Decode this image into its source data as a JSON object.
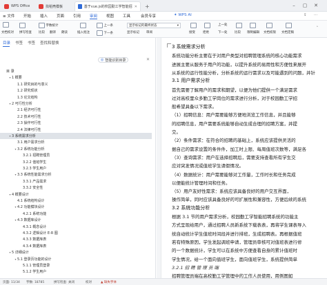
{
  "titlebar": {
    "tabs": [
      {
        "label": "WPS Office",
        "color": "#e23b36"
      },
      {
        "label": "找稻壳模板",
        "color": "#e23b36"
      },
      {
        "label": "基于vue.js的校园勤工学智能招聘系统",
        "color": "#2f6bd8"
      }
    ],
    "add_tab": "+"
  },
  "menubar": {
    "file": "≡ 文件",
    "items": [
      "开始",
      "插入",
      "页面",
      "引用",
      "审阅",
      "视图",
      "工具",
      "会员专享"
    ],
    "active": "审阅",
    "wps_ai": "WPS AI"
  },
  "ribbon": {
    "labels": {
      "doc_check": "文档校对",
      "spell": "拼写检查",
      "word_count": "字数统计",
      "compare": "比较",
      "translate": "翻译",
      "read_aloud": "朗读",
      "insert_comment": "插入批注",
      "prev_comment": "上一条",
      "next_comment": "下一条",
      "show_markup": "显示标记的最终状态",
      "show_markup_menu": "显示标记",
      "review": "审阅",
      "accept": "接受",
      "reject": "拒绝",
      "prev": "上一处",
      "next": "下一处",
      "compare2": "比较",
      "restrict": "限制编辑",
      "doc_rights": "文档权限",
      "doc_locate": "文档定稿"
    }
  },
  "leftpanel": {
    "tabs": [
      "目录",
      "书签",
      "书签",
      "查找和替换"
    ],
    "active": "目录",
    "smart_toc": "智能识别目录",
    "toc": [
      {
        "label": "目 录",
        "level": 0,
        "arrow": ""
      },
      {
        "label": "1 概要",
        "level": 1,
        "arrow": "▾"
      },
      {
        "label": "1.1 研究目的与意义",
        "level": 2,
        "arrow": ""
      },
      {
        "label": "1.2 研究现状",
        "level": 2,
        "arrow": ""
      },
      {
        "label": "1.3 论文结构",
        "level": 2,
        "arrow": ""
      },
      {
        "label": "2 可行性分析",
        "level": 1,
        "arrow": "▾"
      },
      {
        "label": "2.1 经济可行性",
        "level": 2,
        "arrow": ""
      },
      {
        "label": "2.2 技术可行性",
        "level": 2,
        "arrow": ""
      },
      {
        "label": "2.3 操作可行性",
        "level": 2,
        "arrow": ""
      },
      {
        "label": "2.4 法律可行性",
        "level": 2,
        "arrow": ""
      },
      {
        "label": "3 系统需求分析",
        "level": 1,
        "arrow": "▾"
      },
      {
        "label": "3.1 用户需求分析",
        "level": 2,
        "arrow": ""
      },
      {
        "label": "3.2 系统功能分析",
        "level": 2,
        "arrow": "▾"
      },
      {
        "label": "3.2.1 招聘管理员",
        "level": 3,
        "arrow": ""
      },
      {
        "label": "3.2.2 值班学生",
        "level": 3,
        "arrow": ""
      },
      {
        "label": "3.2.3 学生用户",
        "level": 3,
        "arrow": ""
      },
      {
        "label": "3.3 系统性能需求分析",
        "level": 2,
        "arrow": "▾"
      },
      {
        "label": "3.3.1 产品需求",
        "level": 3,
        "arrow": ""
      },
      {
        "label": "3.3.2 安全性",
        "level": 3,
        "arrow": ""
      },
      {
        "label": "4 概要设计",
        "level": 1,
        "arrow": "▾"
      },
      {
        "label": "4.1 系统结构设计",
        "level": 2,
        "arrow": ""
      },
      {
        "label": "4.2 功能模块设计",
        "level": 2,
        "arrow": "▾"
      },
      {
        "label": "4.2.1 系统功能",
        "level": 3,
        "arrow": ""
      },
      {
        "label": "4.3 数据库设计",
        "level": 2,
        "arrow": "▾"
      },
      {
        "label": "4.3.1 概念设计",
        "level": 3,
        "arrow": ""
      },
      {
        "label": "4.3.2 逻辑设计 E-R 图",
        "level": 3,
        "arrow": ""
      },
      {
        "label": "4.3.3 数据库表",
        "level": 3,
        "arrow": ""
      },
      {
        "label": "4.3.4 数据库表",
        "level": 3,
        "arrow": ""
      },
      {
        "label": "5 详细设计",
        "level": 1,
        "arrow": "▾"
      },
      {
        "label": "5.1 登录页功能的设计",
        "level": 2,
        "arrow": "▾"
      },
      {
        "label": "5.1.1 管理员登录",
        "level": 3,
        "arrow": ""
      },
      {
        "label": "5.1.2 学生用户",
        "level": 3,
        "arrow": ""
      }
    ],
    "selected_index": 10
  },
  "document": {
    "lines": [
      {
        "t": "3   系统需求分析",
        "cls": "hd"
      },
      {
        "t": "        系统功能分析主要在于对用户类型对招聘管理系统的核心功能需求",
        "cls": ""
      },
      {
        "t": "进展主要从服务于用户的功能，以提升系统的易用性和方便性来展开",
        "cls": ""
      },
      {
        "t": "从系统的运行性能分析，分析系统的运行需求以及可能遇到的问题，并针",
        "cls": ""
      },
      {
        "t": "3.1   用户需求分析",
        "cls": "hd"
      },
      {
        "t": "        首先需要了解用户的需求和期望，以便为他们提供一个满足需求",
        "cls": ""
      },
      {
        "t": "过对高校里众多勤工学岗位的需求进行分析，对于校园勤工学招",
        "cls": ""
      },
      {
        "t": "般希望具备以下需求。",
        "cls": ""
      },
      {
        "t": "        （1）招聘信息：用户需要能够方便地浏览工作信息，并且能够",
        "cls": ""
      },
      {
        "t": "的招聘信息，用户需要系统能够自动生成合理的招聘方案，并提",
        "cls": ""
      },
      {
        "t": "交。",
        "cls": ""
      },
      {
        "t": "        （2）条件需求：在符合的招聘的基础上，系统应该提供灵活的",
        "cls": ""
      },
      {
        "t": "据自己的需求设置的条件件，加工时上限、每周值班次数等，满足各",
        "cls": ""
      },
      {
        "t": "        （3）查询需求：用户在选择招聘后，需要支持查看所有学生交",
        "cls": ""
      },
      {
        "t": "应对突发情况或值班学生请假情况。",
        "cls": ""
      },
      {
        "t": "        （4）数据统计：用户需要能够对工作量，工作时长和任务完成",
        "cls": ""
      },
      {
        "t": "以便能统计管理时间和任务。",
        "cls": ""
      },
      {
        "t": "        （5）用户友好性需求：系统应该具备良好的用户交互界面，",
        "cls": ""
      },
      {
        "t": "操作简单，同时应该具备良好的可扩展性和兼容性，方便后续的系统",
        "cls": ""
      },
      {
        "t": "3.2   系统功能分析",
        "cls": "hd"
      },
      {
        "t": "        根据 3.1 节的用户需求分析，校园勤工学智能招聘系统的功能主",
        "cls": ""
      },
      {
        "t": "方式呈现给用户，通过招聘人员新系统下载表表，再将学生课表导入",
        "cls": ""
      },
      {
        "t": "统自动统计学生值班时间段并进行排班，生成招聘表。再根据值班",
        "cls": ""
      },
      {
        "t": "若有特殊原因，学生发起调班申请，管理员审核可对值班表进行修",
        "cls": ""
      },
      {
        "t": "的一个数据统计，学生可以在系统中方便查看自身的累计值班时",
        "cls": ""
      },
      {
        "t": "学生情况，给一个面向值班学生，面向值班学生，系统提供简单",
        "cls": ""
      },
      {
        "t": "3.2.1   招 聘 管 理 员 端",
        "cls": "ital"
      },
      {
        "t": "        招聘管理员端在高校勤工学管理中的工作人员使用，用例图如",
        "cls": ""
      }
    ]
  },
  "statusbar": {
    "page": "页面: 11/34",
    "words": "字数: 18785",
    "spell": "拼写检查: 关闭",
    "proof": "校对",
    "font_missing": "缺失字体"
  },
  "colors": {
    "accent": "#2f6bd8",
    "wps_red": "#e23b36",
    "selected_bg": "#dfe3e8"
  }
}
